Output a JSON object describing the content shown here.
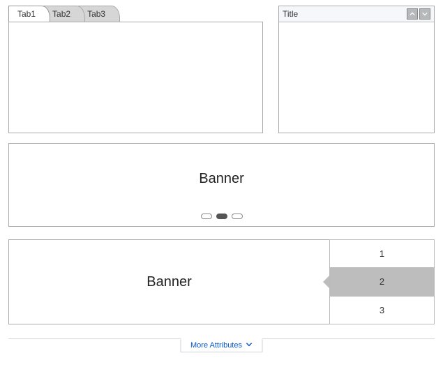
{
  "tabs": {
    "items": [
      {
        "label": "Tab1",
        "active": true
      },
      {
        "label": "Tab2",
        "active": false
      },
      {
        "label": "Tab3",
        "active": false
      }
    ]
  },
  "panel": {
    "title": "Title"
  },
  "carousel1": {
    "text": "Banner",
    "pages": [
      {
        "active": false
      },
      {
        "active": true
      },
      {
        "active": false
      }
    ]
  },
  "carousel2": {
    "text": "Banner",
    "pages": [
      {
        "label": "1",
        "active": false
      },
      {
        "label": "2",
        "active": true
      },
      {
        "label": "3",
        "active": false
      }
    ]
  },
  "footer": {
    "more_label": "More Attributes"
  }
}
